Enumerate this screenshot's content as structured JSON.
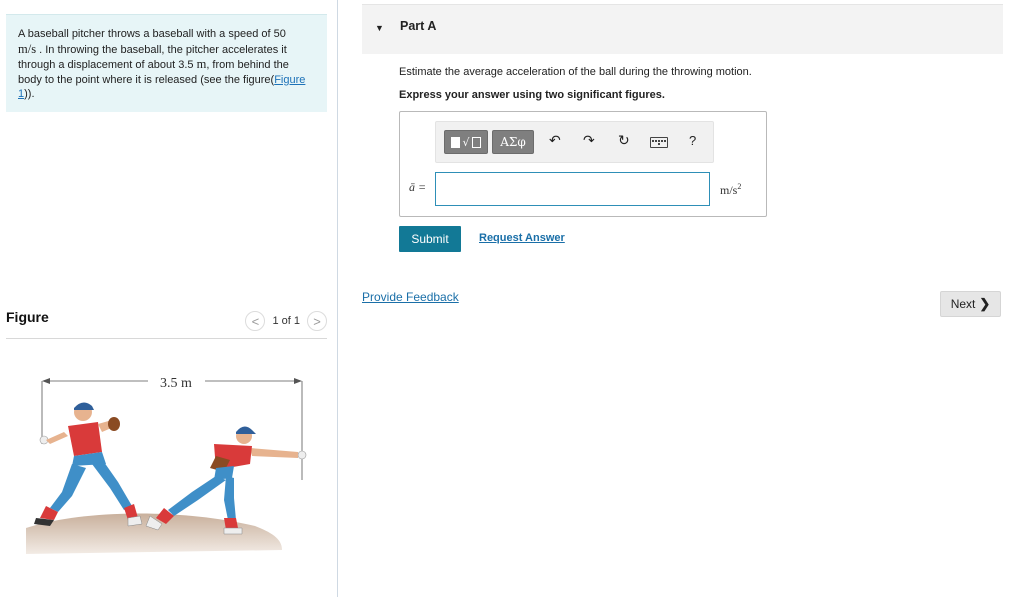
{
  "problem": {
    "text_1": "A baseball pitcher throws a baseball with a speed of 50",
    "unit_speed": "m/s",
    "text_2": ". In throwing the baseball, the pitcher accelerates it through a displacement of about 3.5",
    "unit_distance": "m",
    "text_3": ", from behind the body to the point where it is released (see the figure(",
    "figure_link": "Figure 1",
    "text_4": "))."
  },
  "figure": {
    "title": "Figure",
    "page_indicator": "1 of 1",
    "prev_label": "<",
    "next_label": ">",
    "dimension_label": "3.5 m"
  },
  "part": {
    "caret": "▼",
    "title": "Part A",
    "question": "Estimate the average acceleration of the ball during the throwing motion.",
    "instruction": "Express your answer using two significant figures."
  },
  "toolbar": {
    "templates_icon": "square-root-templates-icon",
    "greek_label": "ΑΣφ",
    "undo_icon": "↶",
    "redo_icon": "↷",
    "reset_icon": "↻",
    "keyboard_icon": "keyboard-icon",
    "help_label": "?"
  },
  "answer": {
    "variable_label": "ā =",
    "value": "",
    "unit": "m/s",
    "unit_exponent": "2"
  },
  "actions": {
    "submit_label": "Submit",
    "request_answer_label": "Request Answer",
    "feedback_label": "Provide Feedback",
    "next_label": "Next"
  },
  "colors": {
    "problem_bg": "#e7f5f7",
    "link": "#1a6fa8",
    "submit_bg": "#127996",
    "input_border": "#2e8fb7",
    "jersey_red": "#d93a3a",
    "pants_blue": "#3f8fc8"
  }
}
